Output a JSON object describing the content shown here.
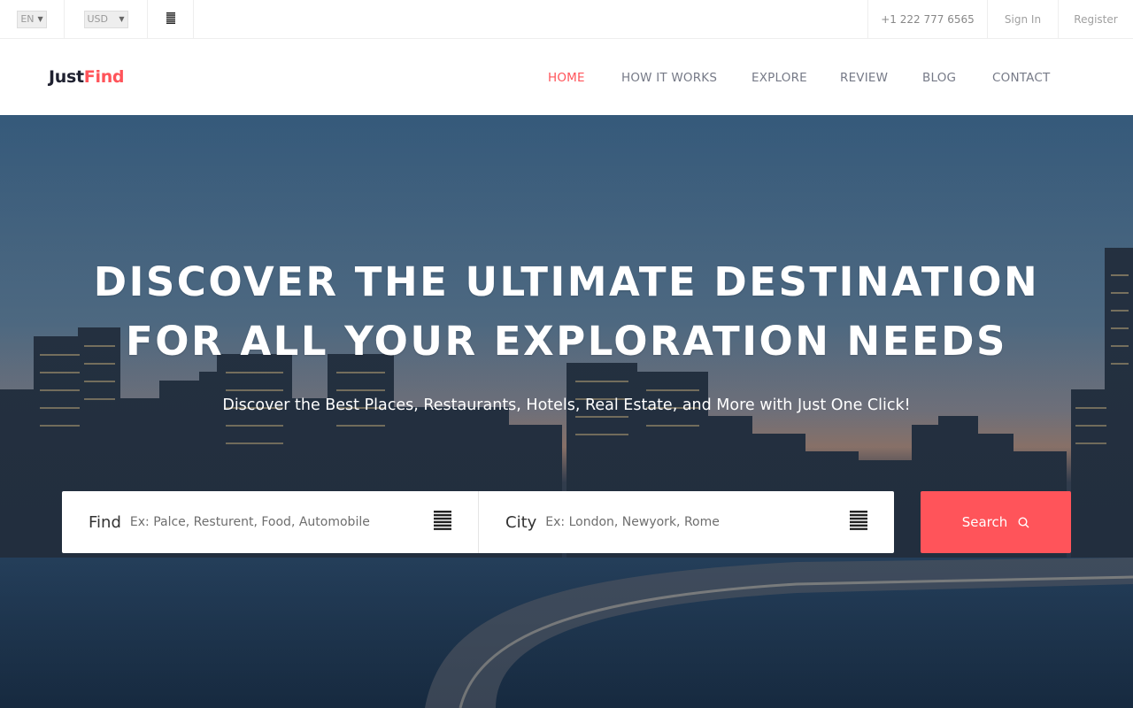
{
  "topbar": {
    "language": "EN",
    "currency": "USD",
    "menu_icon": "menu-icon",
    "phone": "+1 222 777 6565",
    "signin": "Sign In",
    "register": "Register"
  },
  "brand": {
    "name_part1": "Just",
    "name_part2": "Find"
  },
  "nav": {
    "items": [
      "HOME",
      "HOW IT WORKS",
      "EXPLORE",
      "REVIEW",
      "BLOG",
      "CONTACT"
    ],
    "active": "HOME"
  },
  "hero": {
    "title_line1": "DISCOVER THE ULTIMATE DESTINATION",
    "title_line2": "FOR ALL YOUR EXPLORATION NEEDS",
    "subtitle": "Discover the Best Places, Restaurants, Hotels, Real Estate, and More with Just One Click!"
  },
  "search": {
    "find_label": "Find",
    "find_placeholder": "Ex: Palce, Resturent, Food, Automobile",
    "city_label": "City",
    "city_placeholder": "Ex: London, Newyork, Rome",
    "button_label": "Search",
    "button_icon": "search-icon",
    "field_icon": "list-icon"
  },
  "colors": {
    "accent": "#ff545a",
    "dark": "#1f2130",
    "nav_text": "#767a87"
  }
}
